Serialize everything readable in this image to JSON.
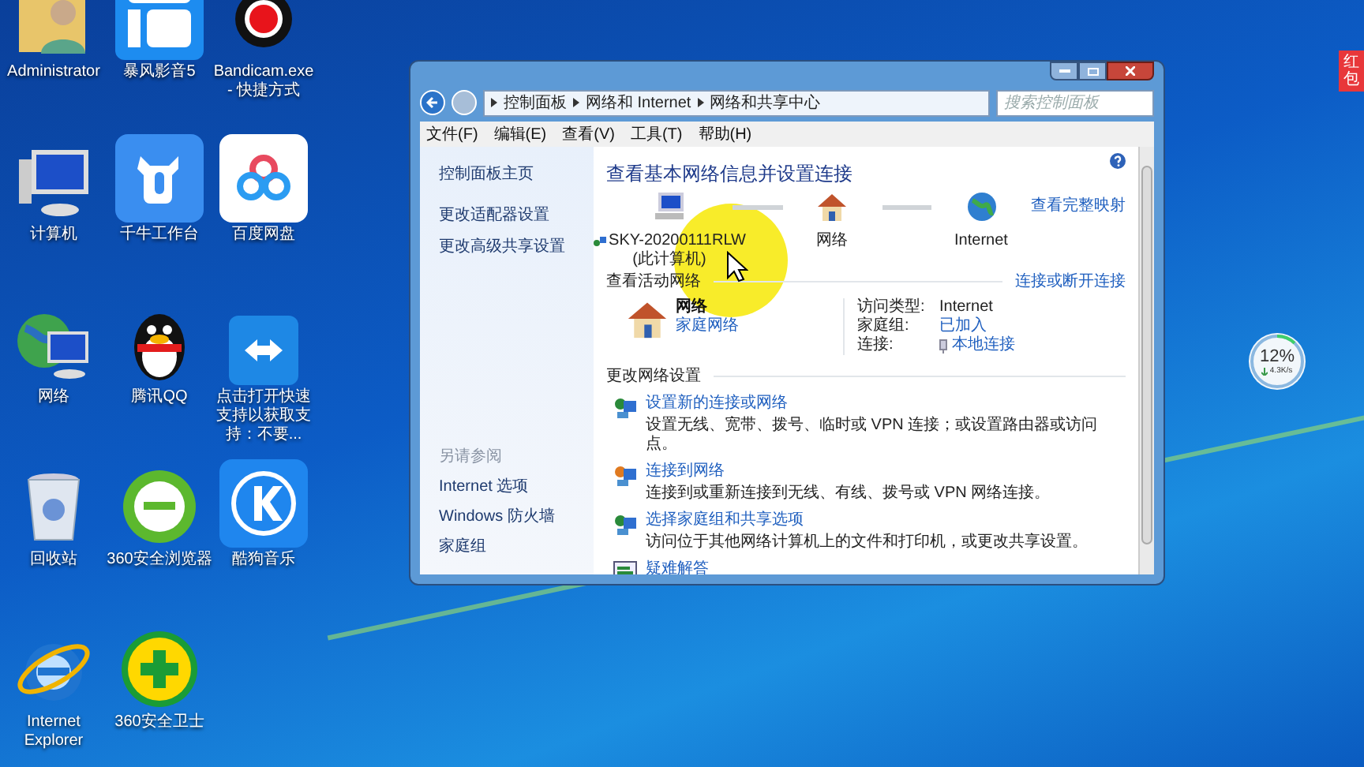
{
  "desktop_icons": [
    {
      "kind": "user",
      "label": "Administrator"
    },
    {
      "kind": "player",
      "label": "暴风影音5"
    },
    {
      "kind": "record",
      "label": "Bandicam.exe - 快捷方式"
    },
    {
      "kind": "computer",
      "label": "计算机"
    },
    {
      "kind": "ox",
      "label": "千牛工作台"
    },
    {
      "kind": "cloud",
      "label": "百度网盘"
    },
    {
      "kind": "network",
      "label": "网络"
    },
    {
      "kind": "penguin",
      "label": "腾讯QQ"
    },
    {
      "kind": "remote",
      "label": "点击打开快速支持以获取支持：不要..."
    },
    {
      "kind": "bin",
      "label": "回收站"
    },
    {
      "kind": "green-e",
      "label": "360安全浏览器"
    },
    {
      "kind": "k",
      "label": "酷狗音乐"
    },
    {
      "kind": "ie",
      "label": "Internet Explorer"
    },
    {
      "kind": "plus",
      "label": "360安全卫士"
    }
  ],
  "window": {
    "breadcrumb": [
      "控制面板",
      "网络和 Internet",
      "网络和共享中心"
    ],
    "search": {
      "placeholder": "搜索控制面板"
    },
    "menu": [
      "文件(F)",
      "编辑(E)",
      "查看(V)",
      "工具(T)",
      "帮助(H)"
    ],
    "sidebar": {
      "links": [
        "控制面板主页",
        "更改适配器设置",
        "更改高级共享设置"
      ],
      "see_also_title": "另请参阅",
      "see_also": [
        "Internet 选项",
        "Windows 防火墙",
        "家庭组"
      ]
    },
    "heading": "查看基本网络信息并设置连接",
    "map": {
      "nodes": [
        {
          "kind": "computer",
          "label": "SKY-20200111RLW",
          "sublabel": "(此计算机)"
        },
        {
          "kind": "house",
          "label": "网络"
        },
        {
          "kind": "globe",
          "label": "Internet"
        }
      ],
      "link": "查看完整映射"
    },
    "active": {
      "title": "查看活动网络",
      "link": "连接或断开连接",
      "name": "网络",
      "type": "家庭网络",
      "props": [
        {
          "key": "访问类型:",
          "value": "Internet",
          "link": false
        },
        {
          "key": "家庭组:",
          "value": "已加入",
          "link": true
        },
        {
          "key": "连接:",
          "value": "本地连接",
          "link": true
        }
      ]
    },
    "settings": {
      "title": "更改网络设置",
      "tasks": [
        {
          "kind": "new",
          "title": "设置新的连接或网络",
          "desc": "设置无线、宽带、拨号、临时或 VPN 连接；或设置路由器或访问点。"
        },
        {
          "kind": "connect",
          "title": "连接到网络",
          "desc": "连接到或重新连接到无线、有线、拨号或 VPN 网络连接。"
        },
        {
          "kind": "share",
          "title": "选择家庭组和共享选项",
          "desc": "访问位于其他网络计算机上的文件和打印机，或更改共享设置。"
        },
        {
          "kind": "fix",
          "title": "疑难解答"
        }
      ]
    }
  },
  "red_badge": "红包",
  "speed_widget": {
    "percent": "12%",
    "speed": "4.3K/s",
    "level": 0.12
  }
}
